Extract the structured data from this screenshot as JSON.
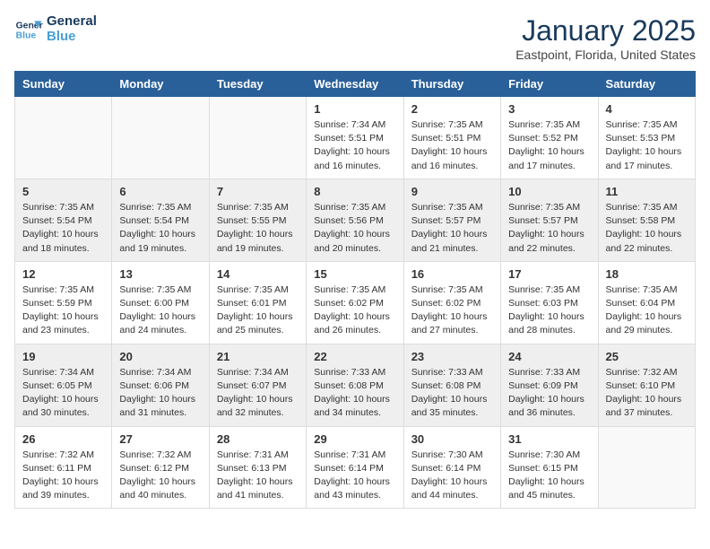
{
  "header": {
    "logo_line1": "General",
    "logo_line2": "Blue",
    "month_title": "January 2025",
    "location": "Eastpoint, Florida, United States"
  },
  "weekdays": [
    "Sunday",
    "Monday",
    "Tuesday",
    "Wednesday",
    "Thursday",
    "Friday",
    "Saturday"
  ],
  "weeks": [
    [
      {
        "day": "",
        "content": ""
      },
      {
        "day": "",
        "content": ""
      },
      {
        "day": "",
        "content": ""
      },
      {
        "day": "1",
        "content": "Sunrise: 7:34 AM\nSunset: 5:51 PM\nDaylight: 10 hours\nand 16 minutes."
      },
      {
        "day": "2",
        "content": "Sunrise: 7:35 AM\nSunset: 5:51 PM\nDaylight: 10 hours\nand 16 minutes."
      },
      {
        "day": "3",
        "content": "Sunrise: 7:35 AM\nSunset: 5:52 PM\nDaylight: 10 hours\nand 17 minutes."
      },
      {
        "day": "4",
        "content": "Sunrise: 7:35 AM\nSunset: 5:53 PM\nDaylight: 10 hours\nand 17 minutes."
      }
    ],
    [
      {
        "day": "5",
        "content": "Sunrise: 7:35 AM\nSunset: 5:54 PM\nDaylight: 10 hours\nand 18 minutes."
      },
      {
        "day": "6",
        "content": "Sunrise: 7:35 AM\nSunset: 5:54 PM\nDaylight: 10 hours\nand 19 minutes."
      },
      {
        "day": "7",
        "content": "Sunrise: 7:35 AM\nSunset: 5:55 PM\nDaylight: 10 hours\nand 19 minutes."
      },
      {
        "day": "8",
        "content": "Sunrise: 7:35 AM\nSunset: 5:56 PM\nDaylight: 10 hours\nand 20 minutes."
      },
      {
        "day": "9",
        "content": "Sunrise: 7:35 AM\nSunset: 5:57 PM\nDaylight: 10 hours\nand 21 minutes."
      },
      {
        "day": "10",
        "content": "Sunrise: 7:35 AM\nSunset: 5:57 PM\nDaylight: 10 hours\nand 22 minutes."
      },
      {
        "day": "11",
        "content": "Sunrise: 7:35 AM\nSunset: 5:58 PM\nDaylight: 10 hours\nand 22 minutes."
      }
    ],
    [
      {
        "day": "12",
        "content": "Sunrise: 7:35 AM\nSunset: 5:59 PM\nDaylight: 10 hours\nand 23 minutes."
      },
      {
        "day": "13",
        "content": "Sunrise: 7:35 AM\nSunset: 6:00 PM\nDaylight: 10 hours\nand 24 minutes."
      },
      {
        "day": "14",
        "content": "Sunrise: 7:35 AM\nSunset: 6:01 PM\nDaylight: 10 hours\nand 25 minutes."
      },
      {
        "day": "15",
        "content": "Sunrise: 7:35 AM\nSunset: 6:02 PM\nDaylight: 10 hours\nand 26 minutes."
      },
      {
        "day": "16",
        "content": "Sunrise: 7:35 AM\nSunset: 6:02 PM\nDaylight: 10 hours\nand 27 minutes."
      },
      {
        "day": "17",
        "content": "Sunrise: 7:35 AM\nSunset: 6:03 PM\nDaylight: 10 hours\nand 28 minutes."
      },
      {
        "day": "18",
        "content": "Sunrise: 7:35 AM\nSunset: 6:04 PM\nDaylight: 10 hours\nand 29 minutes."
      }
    ],
    [
      {
        "day": "19",
        "content": "Sunrise: 7:34 AM\nSunset: 6:05 PM\nDaylight: 10 hours\nand 30 minutes."
      },
      {
        "day": "20",
        "content": "Sunrise: 7:34 AM\nSunset: 6:06 PM\nDaylight: 10 hours\nand 31 minutes."
      },
      {
        "day": "21",
        "content": "Sunrise: 7:34 AM\nSunset: 6:07 PM\nDaylight: 10 hours\nand 32 minutes."
      },
      {
        "day": "22",
        "content": "Sunrise: 7:33 AM\nSunset: 6:08 PM\nDaylight: 10 hours\nand 34 minutes."
      },
      {
        "day": "23",
        "content": "Sunrise: 7:33 AM\nSunset: 6:08 PM\nDaylight: 10 hours\nand 35 minutes."
      },
      {
        "day": "24",
        "content": "Sunrise: 7:33 AM\nSunset: 6:09 PM\nDaylight: 10 hours\nand 36 minutes."
      },
      {
        "day": "25",
        "content": "Sunrise: 7:32 AM\nSunset: 6:10 PM\nDaylight: 10 hours\nand 37 minutes."
      }
    ],
    [
      {
        "day": "26",
        "content": "Sunrise: 7:32 AM\nSunset: 6:11 PM\nDaylight: 10 hours\nand 39 minutes."
      },
      {
        "day": "27",
        "content": "Sunrise: 7:32 AM\nSunset: 6:12 PM\nDaylight: 10 hours\nand 40 minutes."
      },
      {
        "day": "28",
        "content": "Sunrise: 7:31 AM\nSunset: 6:13 PM\nDaylight: 10 hours\nand 41 minutes."
      },
      {
        "day": "29",
        "content": "Sunrise: 7:31 AM\nSunset: 6:14 PM\nDaylight: 10 hours\nand 43 minutes."
      },
      {
        "day": "30",
        "content": "Sunrise: 7:30 AM\nSunset: 6:14 PM\nDaylight: 10 hours\nand 44 minutes."
      },
      {
        "day": "31",
        "content": "Sunrise: 7:30 AM\nSunset: 6:15 PM\nDaylight: 10 hours\nand 45 minutes."
      },
      {
        "day": "",
        "content": ""
      }
    ]
  ]
}
